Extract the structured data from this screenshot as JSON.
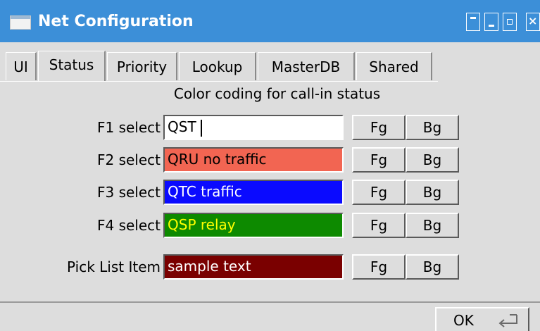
{
  "window": {
    "title": "Net Configuration",
    "close_glyph": "×"
  },
  "tabs": [
    {
      "label": "UI"
    },
    {
      "label": "Status"
    },
    {
      "label": "Priority"
    },
    {
      "label": "Lookup"
    },
    {
      "label": "MasterDB"
    },
    {
      "label": "Shared"
    }
  ],
  "active_tab": "Status",
  "heading": "Color coding for call-in status",
  "rows": [
    {
      "label": "F1 select",
      "value": "QST",
      "fg_color": "#000000",
      "bg_color": "#ffffff",
      "fg_button": "Fg",
      "bg_button": "Bg"
    },
    {
      "label": "F2 select",
      "value": "QRU no traffic",
      "fg_color": "#000000",
      "bg_color": "#f26552",
      "fg_button": "Fg",
      "bg_button": "Bg"
    },
    {
      "label": "F3 select",
      "value": "QTC traffic",
      "fg_color": "#ffffff",
      "bg_color": "#0a0aff",
      "fg_button": "Fg",
      "bg_button": "Bg"
    },
    {
      "label": "F4 select",
      "value": "QSP relay",
      "fg_color": "#ffff00",
      "bg_color": "#0d8a00",
      "fg_button": "Fg",
      "bg_button": "Bg"
    },
    {
      "label": "Pick List Item",
      "value": "sample text",
      "fg_color": "#ffffff",
      "bg_color": "#7a0000",
      "fg_button": "Fg",
      "bg_button": "Bg"
    }
  ],
  "footer": {
    "ok_label": "OK",
    "ok_icon": "enter-key-icon"
  },
  "colors": {
    "titlebar": "#3c8fd8",
    "panel": "#dddddd"
  }
}
